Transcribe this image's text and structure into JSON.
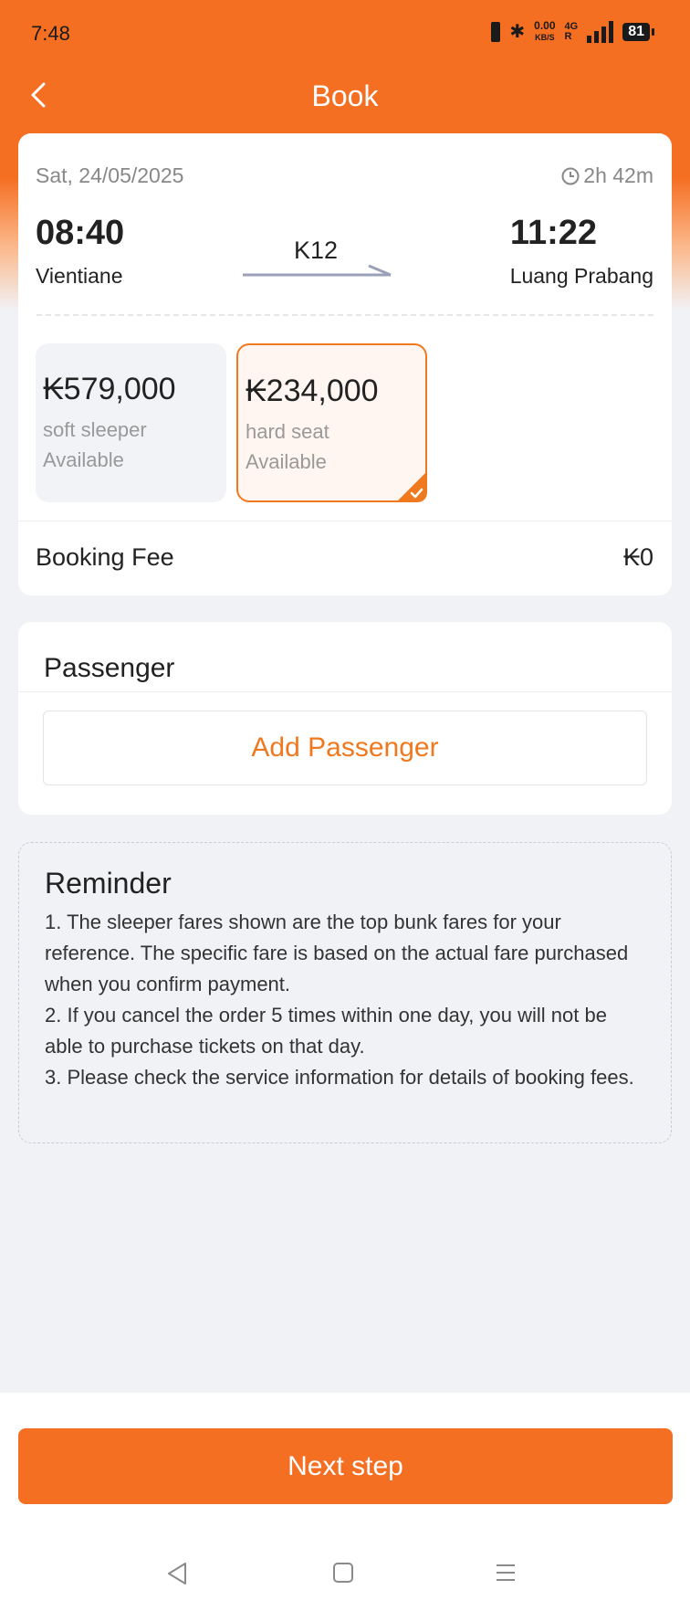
{
  "status_bar": {
    "time": "7:48",
    "net_speed_value": "0.00",
    "net_speed_unit": "KB/S",
    "network_type": "4G",
    "roaming": "R",
    "battery": "81"
  },
  "header": {
    "title": "Book"
  },
  "trip": {
    "date": "Sat, 24/05/2025",
    "duration": "2h 42m",
    "departure_time": "08:40",
    "departure_station": "Vientiane",
    "arrival_time": "11:22",
    "arrival_station": "Luang Prabang",
    "train_number": "K12"
  },
  "fares": [
    {
      "price": "₭579,000",
      "seat_type": "soft sleeper",
      "availability": "Available",
      "selected": false
    },
    {
      "price": "₭234,000",
      "seat_type": "hard seat",
      "availability": "Available",
      "selected": true
    }
  ],
  "booking_fee": {
    "label": "Booking Fee",
    "value": "₭0"
  },
  "passenger": {
    "title": "Passenger",
    "add_label": "Add Passenger"
  },
  "reminder": {
    "title": "Reminder",
    "items": [
      "1. The sleeper fares shown are the top bunk fares for your reference. The specific fare is based on the actual fare purchased when you confirm payment.",
      "2. If you cancel the order 5 times within one day, you will not be able to purchase tickets on that day.",
      "3. Please check the service information for details of booking fees."
    ]
  },
  "footer": {
    "next_label": "Next step"
  },
  "colors": {
    "accent": "#f56f23",
    "background": "#f1f2f6",
    "muted_text": "#999999"
  }
}
